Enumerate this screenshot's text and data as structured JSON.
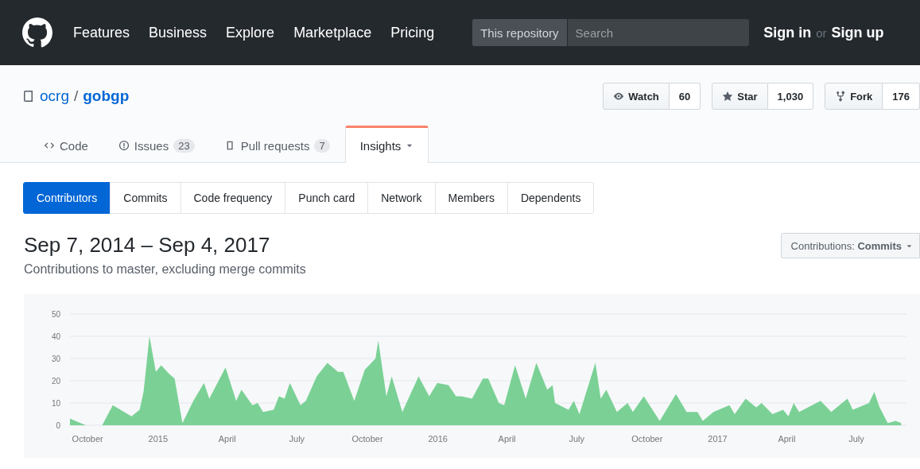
{
  "header": {
    "nav": [
      "Features",
      "Business",
      "Explore",
      "Marketplace",
      "Pricing"
    ],
    "search": {
      "scope": "This repository",
      "placeholder": "Search"
    },
    "sign_in": "Sign in",
    "or": "or",
    "sign_up": "Sign up"
  },
  "repo": {
    "owner": "ocrg",
    "separator": "/",
    "name": "gobgp",
    "actions": [
      {
        "kind": "watch",
        "label": "Watch",
        "count": "60"
      },
      {
        "kind": "star",
        "label": "Star",
        "count": "1,030"
      },
      {
        "kind": "fork",
        "label": "Fork",
        "count": "176"
      }
    ]
  },
  "repo_tabs": [
    {
      "kind": "code",
      "label": "Code",
      "selected": false
    },
    {
      "kind": "issues",
      "label": "Issues",
      "counter": "23",
      "selected": false
    },
    {
      "kind": "pulls",
      "label": "Pull requests",
      "counter": "7",
      "selected": false
    },
    {
      "kind": "insights",
      "label": "Insights",
      "selected": true
    }
  ],
  "insights_tabs": [
    {
      "label": "Contributors",
      "selected": true
    },
    {
      "label": "Commits",
      "selected": false
    },
    {
      "label": "Code frequency",
      "selected": false
    },
    {
      "label": "Punch card",
      "selected": false
    },
    {
      "label": "Network",
      "selected": false
    },
    {
      "label": "Members",
      "selected": false
    },
    {
      "label": "Dependents",
      "selected": false
    }
  ],
  "range_title": "Sep 7, 2014 – Sep 4, 2017",
  "subtitle": "Contributions to master, excluding merge commits",
  "contributions_select": "Contributions: **Commits**",
  "chart_data": {
    "type": "area",
    "grid": true,
    "xlim": [
      2014.685,
      2017.675
    ],
    "ylim": [
      0,
      50
    ],
    "yticks": [
      0,
      10,
      20,
      30,
      40,
      50
    ],
    "xticks": [
      {
        "value": 2014.748,
        "label": "October"
      },
      {
        "value": 2015,
        "label": "2015"
      },
      {
        "value": 2015.247,
        "label": "April"
      },
      {
        "value": 2015.496,
        "label": "July"
      },
      {
        "value": 2015.748,
        "label": "October"
      },
      {
        "value": 2016,
        "label": "2016"
      },
      {
        "value": 2016.247,
        "label": "April"
      },
      {
        "value": 2016.496,
        "label": "July"
      },
      {
        "value": 2016.748,
        "label": "October"
      },
      {
        "value": 2017,
        "label": "2017"
      },
      {
        "value": 2017.247,
        "label": "April"
      },
      {
        "value": 2017.496,
        "label": "July"
      }
    ],
    "x": [
      2014.685,
      2014.704,
      2014.742,
      2014.8,
      2014.838,
      2014.905,
      2014.934,
      2014.948,
      2014.969,
      2014.992,
      2015.011,
      2015.04,
      2015.059,
      2015.087,
      2015.126,
      2015.164,
      2015.183,
      2015.241,
      2015.279,
      2015.298,
      2015.337,
      2015.356,
      2015.375,
      2015.413,
      2015.432,
      2015.452,
      2015.471,
      2015.509,
      2015.528,
      2015.567,
      2015.605,
      2015.643,
      2015.662,
      2015.701,
      2015.739,
      2015.777,
      2015.787,
      2015.816,
      2015.835,
      2015.873,
      2015.931,
      2015.969,
      2015.998,
      2016.038,
      2016.065,
      2016.084,
      2016.122,
      2016.161,
      2016.18,
      2016.218,
      2016.237,
      2016.276,
      2016.314,
      2016.352,
      2016.391,
      2016.41,
      2016.419,
      2016.467,
      2016.486,
      2016.506,
      2016.563,
      2016.582,
      2016.602,
      2016.64,
      2016.678,
      2016.697,
      2016.736,
      2016.793,
      2016.851,
      2016.889,
      2016.928,
      2016.947,
      2016.985,
      2017.042,
      2017.061,
      2017.1,
      2017.138,
      2017.157,
      2017.196,
      2017.234,
      2017.253,
      2017.272,
      2017.291,
      2017.368,
      2017.406,
      2017.464,
      2017.483,
      2017.541,
      2017.56,
      2017.579,
      2017.608,
      2017.636,
      2017.656
    ],
    "series": [
      {
        "color": "#7bd195",
        "values": [
          3,
          2,
          0,
          0,
          9,
          4,
          7,
          15,
          40,
          24,
          27,
          23,
          21,
          1,
          11,
          19,
          12,
          26,
          11,
          16,
          9,
          10,
          6,
          7,
          13,
          12,
          19,
          9,
          11,
          22,
          28,
          24,
          24,
          11,
          25,
          30,
          38,
          13,
          22,
          6,
          22,
          13,
          19,
          18,
          13,
          13,
          12,
          21,
          21,
          10,
          9,
          27,
          12,
          28,
          16,
          18,
          10,
          7,
          11,
          5,
          28,
          12,
          16,
          6,
          10,
          6,
          13,
          2,
          14,
          6,
          6,
          2,
          6,
          9,
          5,
          12,
          8,
          10,
          5,
          7,
          4,
          10,
          6,
          11,
          6,
          12,
          7,
          10,
          15,
          8,
          1,
          2,
          1
        ]
      }
    ]
  }
}
